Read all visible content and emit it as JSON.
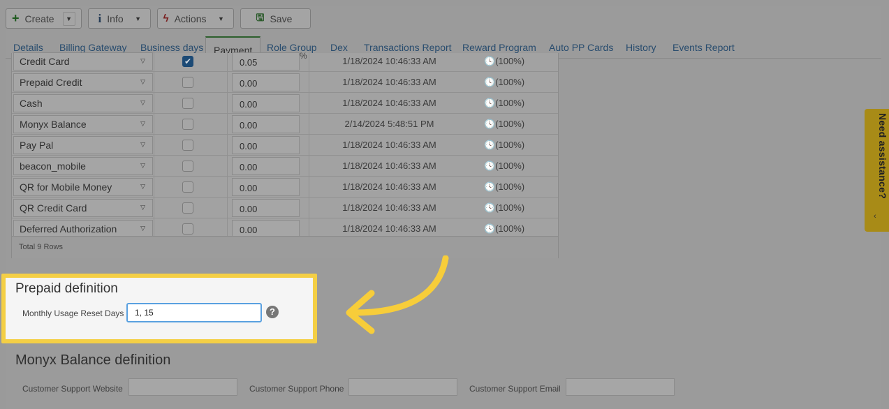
{
  "toolbar": {
    "create_label": "Create",
    "info_label": "Info",
    "actions_label": "Actions",
    "save_label": "Save"
  },
  "tabs": [
    {
      "label": "Details"
    },
    {
      "label": "Billing Gateway"
    },
    {
      "label": "Business days"
    },
    {
      "label": "Payment"
    },
    {
      "label": "Role Group"
    },
    {
      "label": "Dex"
    },
    {
      "label": "Transactions Report"
    },
    {
      "label": "Reward Program"
    },
    {
      "label": "Auto PP Cards"
    },
    {
      "label": "History"
    },
    {
      "label": "Events Report"
    }
  ],
  "active_tab": "Payment",
  "payment_table": {
    "rows": [
      {
        "name": "Credit Card",
        "checked": true,
        "amount": "0.05",
        "unit": "%",
        "date": "1/18/2024 10:46:33 AM",
        "status": "(100%)"
      },
      {
        "name": "Prepaid Credit",
        "checked": false,
        "amount": "0.00",
        "date": "1/18/2024 10:46:33 AM",
        "status": "(100%)"
      },
      {
        "name": "Cash",
        "checked": false,
        "amount": "0.00",
        "date": "1/18/2024 10:46:33 AM",
        "status": "(100%)"
      },
      {
        "name": "Monyx Balance",
        "checked": false,
        "amount": "0.00",
        "date": "2/14/2024 5:48:51 PM",
        "status": "(100%)"
      },
      {
        "name": "Pay Pal",
        "checked": false,
        "amount": "0.00",
        "date": "1/18/2024 10:46:33 AM",
        "status": "(100%)"
      },
      {
        "name": "beacon_mobile",
        "checked": false,
        "amount": "0.00",
        "date": "1/18/2024 10:46:33 AM",
        "status": "(100%)"
      },
      {
        "name": "QR for Mobile Money",
        "checked": false,
        "amount": "0.00",
        "date": "1/18/2024 10:46:33 AM",
        "status": "(100%)"
      },
      {
        "name": "QR Credit Card",
        "checked": false,
        "amount": "0.00",
        "date": "1/18/2024 10:46:33 AM",
        "status": "(100%)"
      },
      {
        "name": "Deferred Authorization",
        "checked": false,
        "amount": "0.00",
        "date": "1/18/2024 10:46:33 AM",
        "status": "(100%)"
      }
    ],
    "footer": "Total 9 Rows"
  },
  "prepaid": {
    "title": "Prepaid definition",
    "reset_days_label": "Monthly Usage Reset Days",
    "reset_days_value": "1, 15"
  },
  "monyx": {
    "title": "Monyx Balance definition",
    "website_label": "Customer Support Website",
    "phone_label": "Customer Support Phone",
    "email_label": "Customer Support Email"
  },
  "assistance": {
    "label": "Need assistance?"
  },
  "colors": {
    "highlight_border": "#f4cf45",
    "arrow": "#f7cd3a",
    "input_focus": "#5aa1e0",
    "assist_tab": "#a88b17"
  }
}
